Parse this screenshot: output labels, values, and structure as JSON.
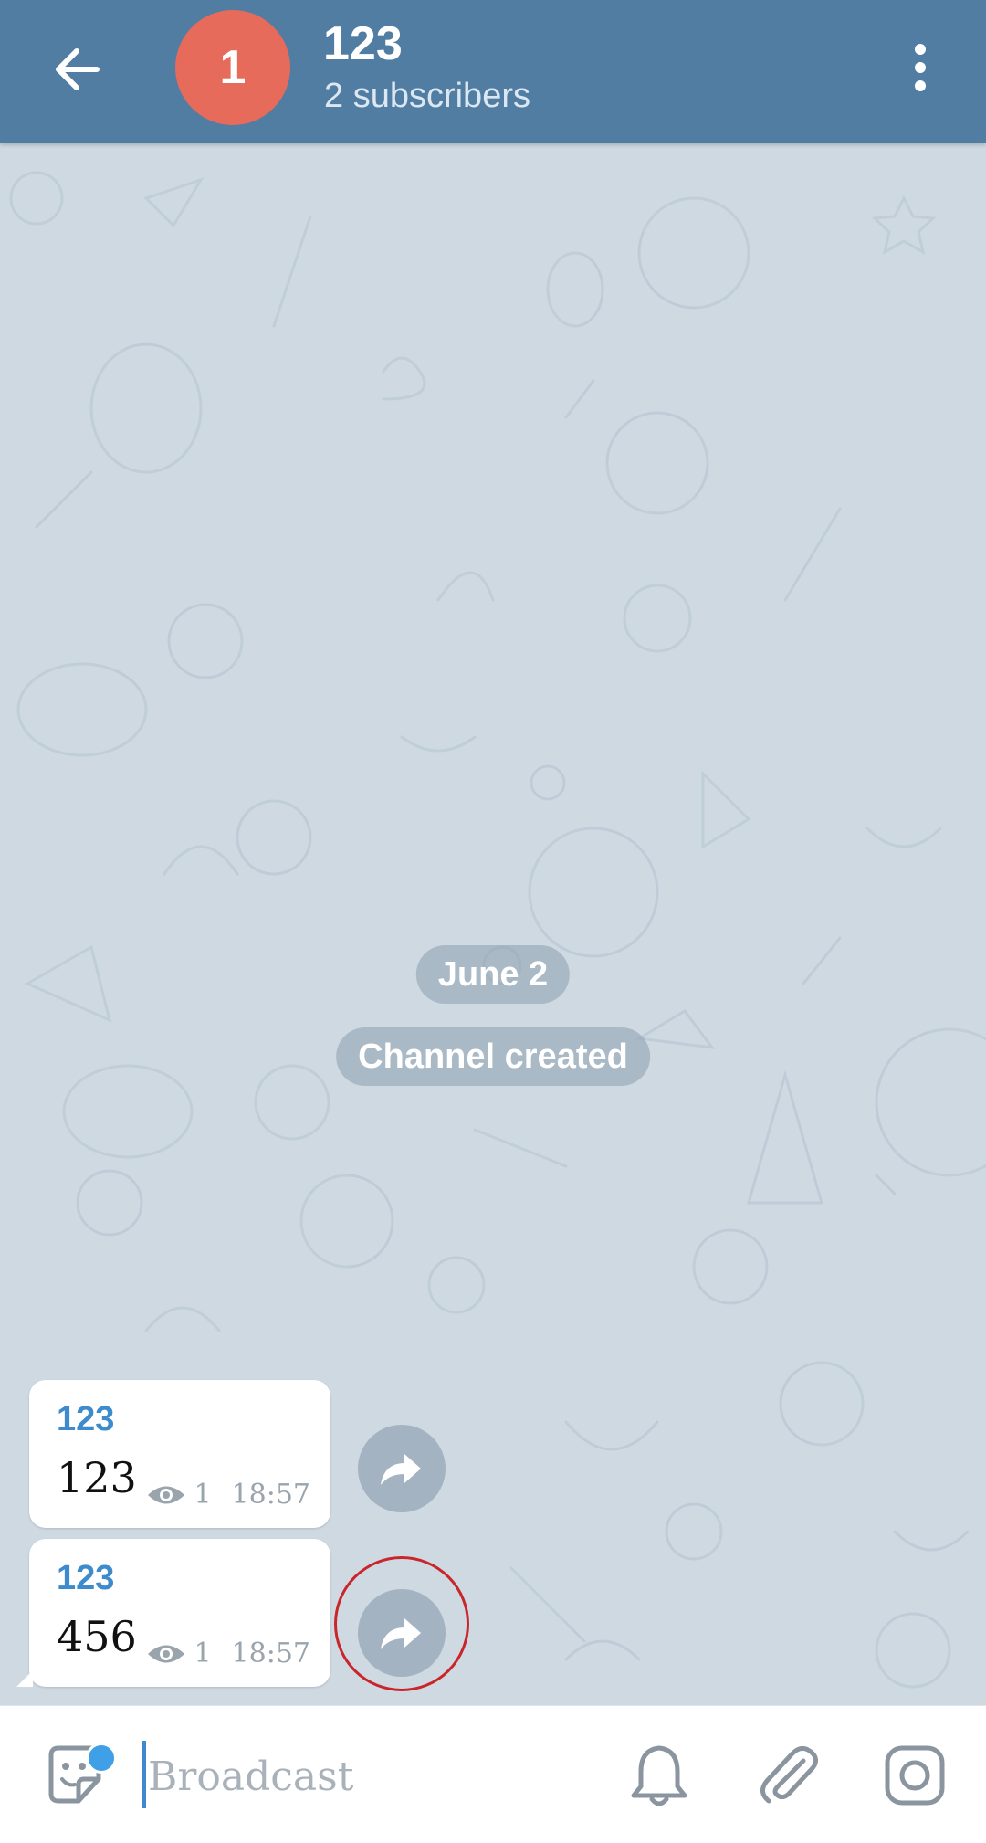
{
  "header": {
    "avatar_letter": "1",
    "title": "123",
    "subtitle": "2 subscribers",
    "avatar_color": "#e66b5b",
    "bar_color": "#527da3"
  },
  "chat": {
    "date_label": "June 2",
    "service_message": "Channel created",
    "messages": [
      {
        "sender": "123",
        "text": "123",
        "views": "1",
        "time": "18:57"
      },
      {
        "sender": "123",
        "text": "456",
        "views": "1",
        "time": "18:57"
      }
    ]
  },
  "input": {
    "placeholder": "Broadcast"
  },
  "icons": {
    "back": "arrow-left-icon",
    "menu": "more-vertical-icon",
    "share": "share-forward-icon",
    "emoji": "sticker-icon",
    "mute": "bell-icon",
    "attach": "paperclip-icon",
    "camera": "instagram-camera-icon"
  }
}
